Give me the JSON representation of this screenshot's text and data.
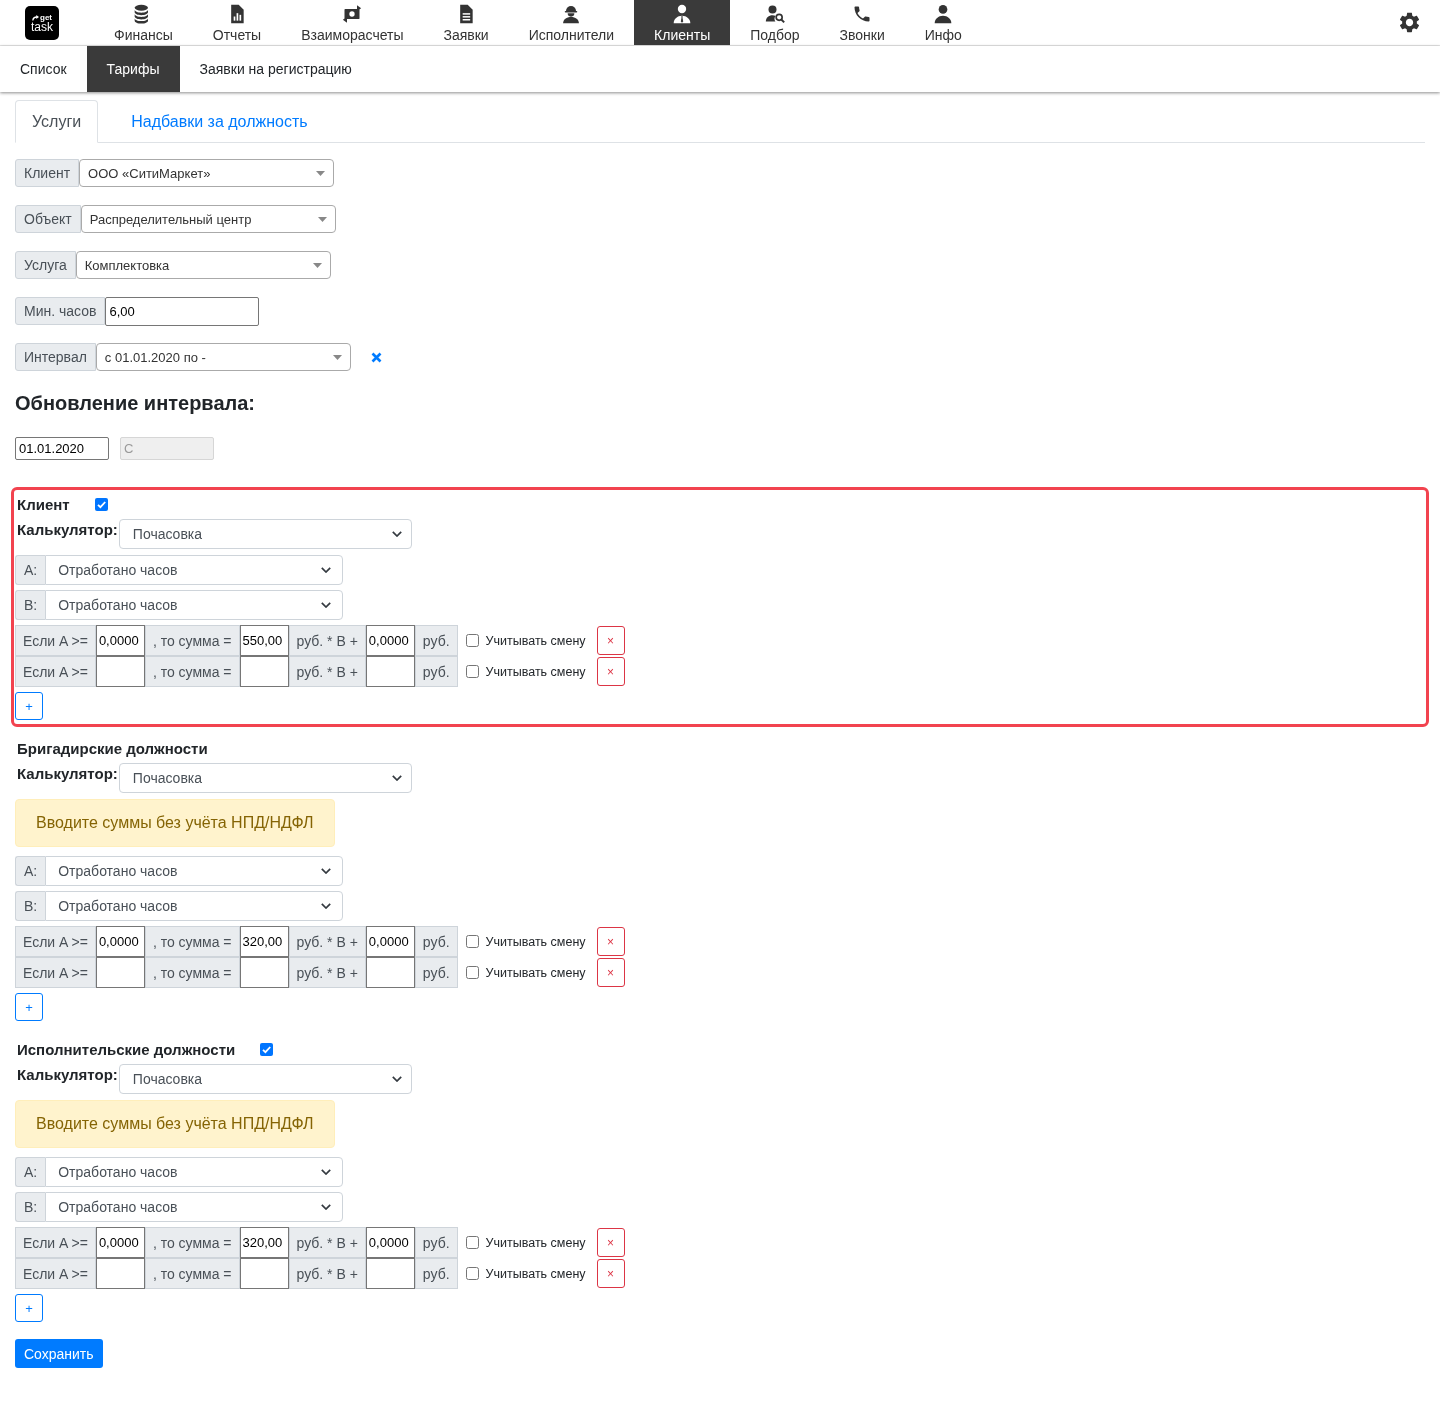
{
  "top_nav": {
    "logo": {
      "line_1": "get",
      "line_2": "task"
    },
    "items": [
      {
        "label": "Финансы",
        "selected": false
      },
      {
        "label": "Отчеты",
        "selected": false
      },
      {
        "label": "Взаиморасчеты",
        "selected": false
      },
      {
        "label": "Заявки",
        "selected": false
      },
      {
        "label": "Исполнители",
        "selected": false
      },
      {
        "label": "Клиенты",
        "selected": true
      },
      {
        "label": "Подбор",
        "selected": false
      },
      {
        "label": "Звонки",
        "selected": false
      },
      {
        "label": "Инфо",
        "selected": false
      }
    ]
  },
  "sub_nav": {
    "items": [
      {
        "label": "Список",
        "selected": false
      },
      {
        "label": "Тарифы",
        "selected": true
      },
      {
        "label": "Заявки на регистрацию",
        "selected": false
      }
    ]
  },
  "tabs": [
    {
      "label": "Услуги",
      "selected": true
    },
    {
      "label": "Надбавки за должность",
      "selected": false
    }
  ],
  "fields": [
    {
      "kind": "select",
      "label": "Клиент",
      "value": "ООО «СитиМаркет»",
      "clearable": false
    },
    {
      "kind": "select",
      "label": "Объект",
      "value": "Распределительный центр",
      "clearable": false
    },
    {
      "kind": "select",
      "label": "Услуга",
      "value": "Комплектовка",
      "clearable": false
    },
    {
      "kind": "input",
      "label": "Мин. часов",
      "value": "6,00",
      "clearable": false
    },
    {
      "kind": "select",
      "label": "Интервал",
      "value": "с 01.01.2020 по -",
      "clearable": true
    }
  ],
  "interval_update": {
    "title": "Обновление интервала:",
    "start_date": {
      "value": "01.01.2020",
      "disabled": false
    },
    "end_date": {
      "placeholder": "С",
      "disabled": true
    }
  },
  "sections": [
    {
      "title": "Клиент",
      "checked": true,
      "highlighted": true,
      "calculator_label": "Калькулятор:",
      "calculator": "Почасовка",
      "variables": [
        {
          "label": "A:",
          "value": "Отработано часов"
        },
        {
          "label": "B:",
          "value": "Отработано часов"
        }
      ],
      "rules": [
        {
          "condition": "Если A >=",
          "min_a": "0,0000",
          "then": ", то сумма =",
          "rate": "550,00",
          "rate_unit": "руб. * B +",
          "fixed": "0,0000",
          "unit": "руб.",
          "shift_label": "Учитывать смену",
          "shift_checked": false,
          "remove": "×"
        },
        {
          "condition": "Если A >=",
          "then": ", то сумма =",
          "rate_unit": "руб. * B +",
          "unit": "руб.",
          "shift_label": "Учитывать смену",
          "shift_checked": false,
          "remove": "×"
        }
      ],
      "add_button": "+"
    },
    {
      "title": "Бригадирские должности",
      "highlighted": false,
      "calculator_label": "Калькулятор:",
      "calculator": "Почасовка",
      "notice": "Вводите суммы без учёта НПД/НДФЛ",
      "variables": [
        {
          "label": "A:",
          "value": "Отработано часов"
        },
        {
          "label": "B:",
          "value": "Отработано часов"
        }
      ],
      "rules": [
        {
          "condition": "Если A >=",
          "min_a": "0,0000",
          "then": ", то сумма =",
          "rate": "320,00",
          "rate_unit": "руб. * B +",
          "fixed": "0,0000",
          "unit": "руб.",
          "shift_label": "Учитывать смену",
          "shift_checked": false,
          "remove": "×"
        },
        {
          "condition": "Если A >=",
          "then": ", то сумма =",
          "rate_unit": "руб. * B +",
          "unit": "руб.",
          "shift_label": "Учитывать смену",
          "shift_checked": false,
          "remove": "×"
        }
      ],
      "add_button": "+"
    },
    {
      "title": "Исполнительские должности",
      "checked": true,
      "highlighted": false,
      "calculator_label": "Калькулятор:",
      "calculator": "Почасовка",
      "notice": "Вводите суммы без учёта НПД/НДФЛ",
      "variables": [
        {
          "label": "A:",
          "value": "Отработано часов"
        },
        {
          "label": "B:",
          "value": "Отработано часов"
        }
      ],
      "rules": [
        {
          "condition": "Если A >=",
          "min_a": "0,0000",
          "then": ", то сумма =",
          "rate": "320,00",
          "rate_unit": "руб. * B +",
          "fixed": "0,0000",
          "unit": "руб.",
          "shift_label": "Учитывать смену",
          "shift_checked": false,
          "remove": "×"
        },
        {
          "condition": "Если A >=",
          "then": ", то сумма =",
          "rate_unit": "руб. * B +",
          "unit": "руб.",
          "shift_label": "Учитывать смену",
          "shift_checked": false,
          "remove": "×"
        }
      ],
      "add_button": "+"
    }
  ],
  "save_button": "Сохранить"
}
